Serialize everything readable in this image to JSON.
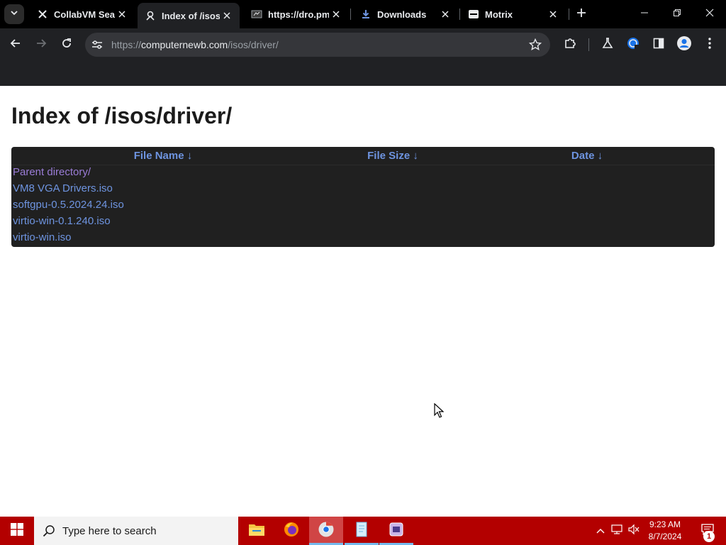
{
  "tabs": [
    {
      "title": "CollabVM Sear",
      "favicon": "collabvm-icon",
      "active": false
    },
    {
      "title": "Index of /isos/",
      "favicon": "index-icon",
      "active": true
    },
    {
      "title": "https://dro.pm",
      "favicon": "dropm-icon",
      "active": false
    },
    {
      "title": "Downloads",
      "favicon": "download-icon",
      "active": false
    },
    {
      "title": "Motrix",
      "favicon": "motrix-icon",
      "active": false
    }
  ],
  "address_bar": {
    "scheme": "https://",
    "host": "computernewb.com",
    "path": "/isos/driver/"
  },
  "page": {
    "heading": "Index of /isos/driver/",
    "columns": [
      {
        "label": "File Name",
        "sort_icon": "↓"
      },
      {
        "label": "File Size",
        "sort_icon": "↓"
      },
      {
        "label": "Date",
        "sort_icon": "↓"
      }
    ],
    "rows": [
      {
        "name": "Parent directory/",
        "size": "",
        "date": ""
      },
      {
        "name": "VM8 VGA Drivers.iso",
        "size": "",
        "date": ""
      },
      {
        "name": "softgpu-0.5.2024.24.iso",
        "size": "",
        "date": ""
      },
      {
        "name": "virtio-win-0.1.240.iso",
        "size": "",
        "date": ""
      },
      {
        "name": "virtio-win.iso",
        "size": "",
        "date": ""
      }
    ]
  },
  "taskbar": {
    "search_placeholder": "Type here to search",
    "apps": [
      "file-explorer-icon",
      "firefox-icon",
      "chrome-icon",
      "notepad-icon",
      "virtualbox-icon"
    ],
    "time": "9:23 AM",
    "date": "8/7/2024",
    "notification_count": "1"
  },
  "colors": {
    "link": "#6e94e0",
    "visited_link": "#9a7cd6",
    "table_background": "#202020",
    "taskbar": "#b30000"
  }
}
